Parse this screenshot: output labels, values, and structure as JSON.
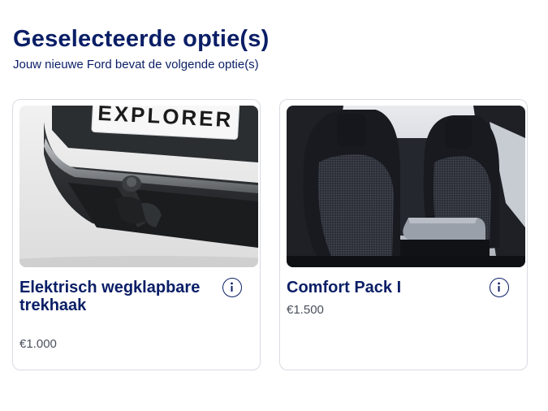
{
  "header": {
    "title": "Geselecteerde optie(s)",
    "subtitle": "Jouw nieuwe Ford bevat de volgende optie(s)"
  },
  "options": [
    {
      "name": "Elektrisch wegklapbare trekhaak",
      "price": "€1.000",
      "image_text": "EXPLORER",
      "image": "towbar-photo",
      "info_icon": "info-icon"
    },
    {
      "name": "Comfort Pack I",
      "price": "€1.500",
      "image": "seats-photo",
      "info_icon": "info-icon"
    }
  ],
  "colors": {
    "brand": "#0a1e66",
    "price": "#4a4f5c",
    "border": "#d9dbe2"
  }
}
